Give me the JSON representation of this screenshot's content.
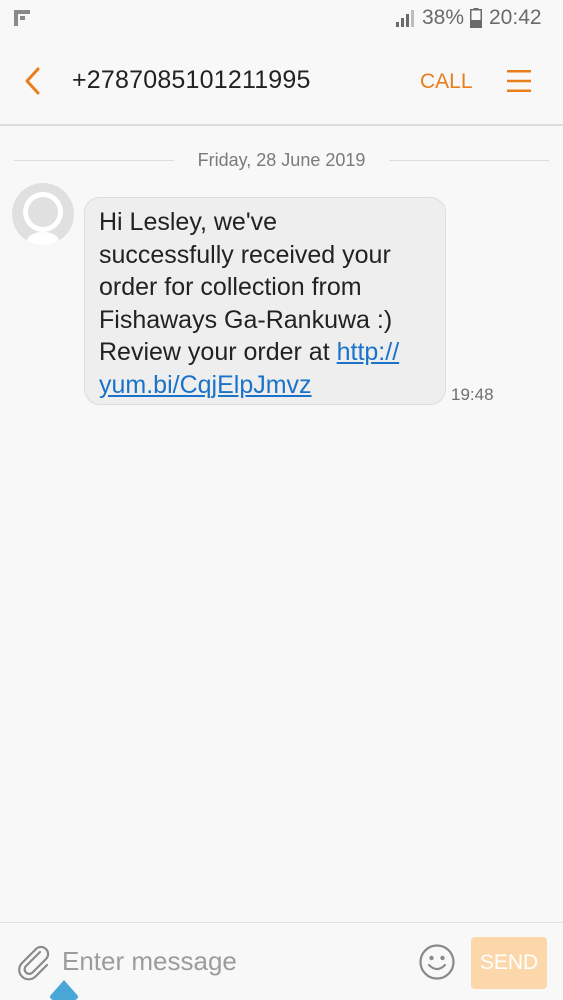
{
  "status_bar": {
    "battery_percent": "38%",
    "time": "20:42",
    "icons": [
      "notification-icon",
      "signal-icon",
      "battery-icon"
    ]
  },
  "header": {
    "contact": "+2787085101211995",
    "call_label": "CALL",
    "icons": [
      "back-arrow-icon",
      "menu-icon"
    ]
  },
  "conversation": {
    "date": "Friday, 28 June 2019",
    "messages": [
      {
        "lines": [
          "Hi Lesley, we've",
          "successfully received your",
          "order for collection from",
          "Fishaways Ga-Rankuwa :)"
        ],
        "prefix": "Review your order at ",
        "link_line1": "http://",
        "link_line2": "yum.bi/CqjElpJmvz",
        "time": "19:48"
      }
    ]
  },
  "composer": {
    "placeholder": "Enter message",
    "send_label": "SEND",
    "icons": [
      "attach-icon",
      "emoji-icon"
    ]
  },
  "colors": {
    "accent": "#e87f1c",
    "link": "#1a73c9",
    "bubble": "#eeeeee",
    "background": "#f8f8f8",
    "send_button": "#fbd7a9"
  }
}
